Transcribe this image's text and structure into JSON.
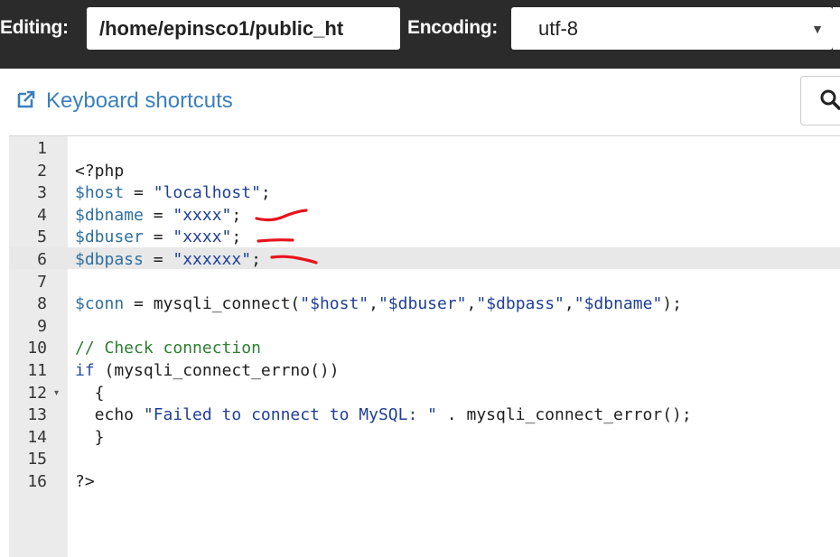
{
  "toolbar": {
    "editing_label": "Editing:",
    "file_path": "/home/epinsco1/public_ht",
    "encoding_label": "Encoding:",
    "encoding_value": "utf-8"
  },
  "shortcuts": {
    "link_label": "Keyboard shortcuts",
    "link_icon": "external-link-icon",
    "search_icon": "search-icon"
  },
  "editor": {
    "lines": [
      {
        "number": "1",
        "tokens": []
      },
      {
        "number": "2",
        "tokens": [
          {
            "t": "<?php",
            "c": ""
          }
        ]
      },
      {
        "number": "3",
        "tokens": [
          {
            "t": "$host",
            "c": "t-var"
          },
          {
            "t": " = ",
            "c": ""
          },
          {
            "t": "\"localhost\"",
            "c": "t-str"
          },
          {
            "t": ";",
            "c": ""
          }
        ]
      },
      {
        "number": "4",
        "tokens": [
          {
            "t": "$dbname",
            "c": "t-var"
          },
          {
            "t": " = ",
            "c": ""
          },
          {
            "t": "\"xxxx\"",
            "c": "t-str"
          },
          {
            "t": ";",
            "c": ""
          }
        ]
      },
      {
        "number": "5",
        "tokens": [
          {
            "t": "$dbuser",
            "c": "t-var"
          },
          {
            "t": " = ",
            "c": ""
          },
          {
            "t": "\"xxxx\"",
            "c": "t-str"
          },
          {
            "t": ";",
            "c": ""
          }
        ]
      },
      {
        "number": "6",
        "tokens": [
          {
            "t": "$dbpass",
            "c": "t-var"
          },
          {
            "t": " = ",
            "c": ""
          },
          {
            "t": "\"xxxxxx\"",
            "c": "t-str"
          },
          {
            "t": ";",
            "c": ""
          }
        ]
      },
      {
        "number": "7",
        "tokens": []
      },
      {
        "number": "8",
        "tokens": [
          {
            "t": "$conn",
            "c": "t-var"
          },
          {
            "t": " = mysqli_connect(",
            "c": ""
          },
          {
            "t": "\"$host\"",
            "c": "t-str"
          },
          {
            "t": ",",
            "c": ""
          },
          {
            "t": "\"$dbuser\"",
            "c": "t-str"
          },
          {
            "t": ",",
            "c": ""
          },
          {
            "t": "\"$dbpass\"",
            "c": "t-str"
          },
          {
            "t": ",",
            "c": ""
          },
          {
            "t": "\"$dbname\"",
            "c": "t-str"
          },
          {
            "t": ");",
            "c": ""
          }
        ]
      },
      {
        "number": "9",
        "tokens": []
      },
      {
        "number": "10",
        "tokens": [
          {
            "t": "// Check connection",
            "c": "t-com"
          }
        ]
      },
      {
        "number": "11",
        "tokens": [
          {
            "t": "if",
            "c": "t-kw"
          },
          {
            "t": " (mysqli_connect_errno())",
            "c": ""
          }
        ]
      },
      {
        "number": "12",
        "fold": "▾",
        "tokens": [
          {
            "t": "  {",
            "c": ""
          }
        ]
      },
      {
        "number": "13",
        "tokens": [
          {
            "t": "  echo ",
            "c": ""
          },
          {
            "t": "\"Failed to connect to MySQL: \"",
            "c": "t-str"
          },
          {
            "t": " . mysqli_connect_error();",
            "c": ""
          }
        ]
      },
      {
        "number": "14",
        "tokens": [
          {
            "t": "  }",
            "c": ""
          }
        ]
      },
      {
        "number": "15",
        "tokens": []
      },
      {
        "number": "16",
        "tokens": [
          {
            "t": "?>",
            "c": ""
          }
        ]
      }
    ]
  },
  "colors": {
    "toolbar_bg": "#2b2b2b",
    "link": "#3a7fc0",
    "gutter": "#ebebeb",
    "annotation": "#e8131b"
  }
}
